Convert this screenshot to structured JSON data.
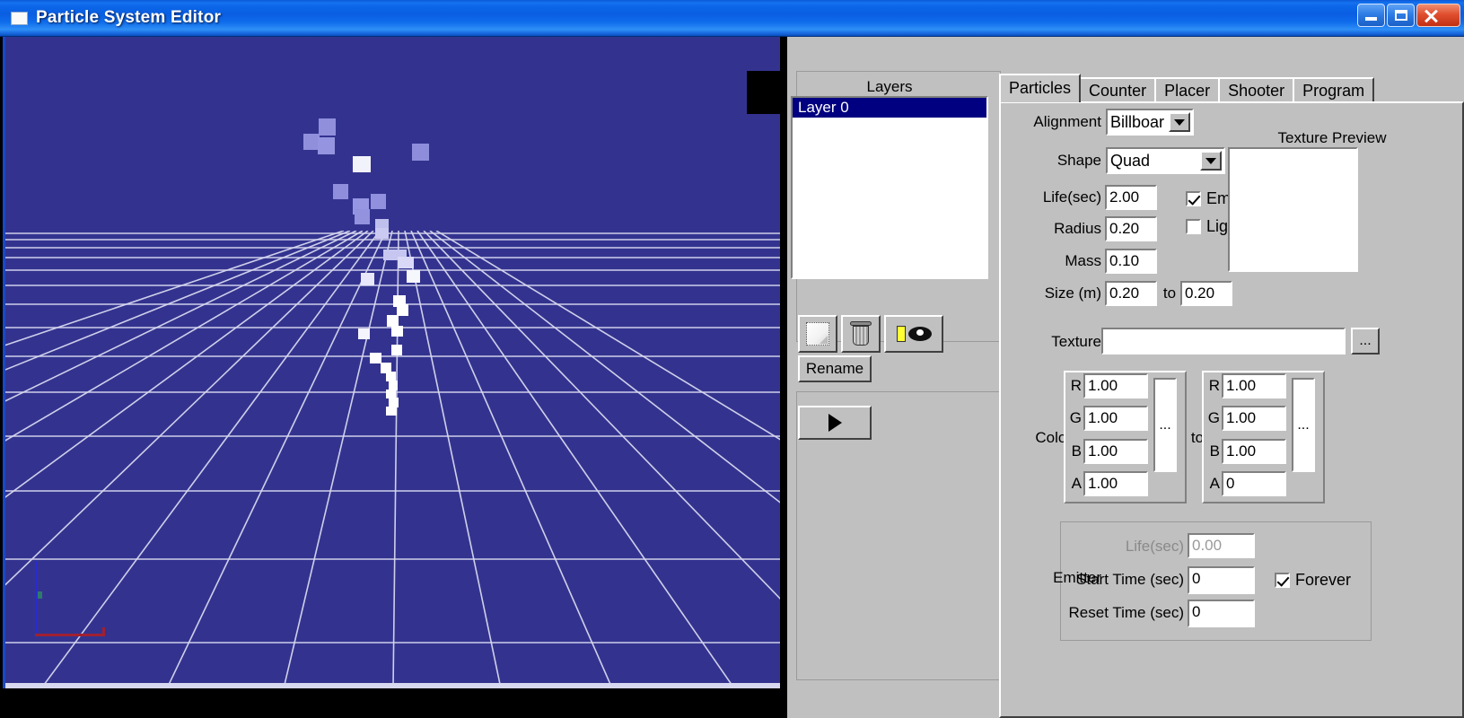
{
  "window": {
    "title": "Particle System Editor",
    "icon": "app-window-icon",
    "buttons": {
      "minimize": "minimize",
      "maximize": "maximize",
      "close": "close"
    }
  },
  "viewport": {
    "background_color": "#33338f",
    "grid_color": "#d8d8f0",
    "particle_color": "#ffffff",
    "axis_y_color": "#2a2ad0",
    "axis_x_color": "#a02030"
  },
  "layers_panel": {
    "title": "Layers",
    "items": [
      {
        "label": "Layer 0",
        "selected": true
      }
    ],
    "tools": [
      {
        "name": "new-layer",
        "icon": "page-icon"
      },
      {
        "name": "delete-layer",
        "icon": "trash-icon"
      },
      {
        "name": "layer-visibility",
        "icon": "eye-icon"
      }
    ],
    "rename_label": "Rename",
    "play_label": "play-icon"
  },
  "tabs": [
    {
      "label": "Particles",
      "active": true
    },
    {
      "label": "Counter",
      "active": false
    },
    {
      "label": "Placer",
      "active": false
    },
    {
      "label": "Shooter",
      "active": false
    },
    {
      "label": "Program",
      "active": false
    }
  ],
  "particles": {
    "alignment": {
      "label": "Alignment",
      "value": "Billboar"
    },
    "shape": {
      "label": "Shape",
      "value": "Quad"
    },
    "life": {
      "label": "Life(sec)",
      "value": "2.00"
    },
    "radius": {
      "label": "Radius",
      "value": "0.20"
    },
    "mass": {
      "label": "Mass",
      "value": "0.10"
    },
    "size": {
      "label": "Size (m)",
      "value_min": "0.20",
      "to_label": "to",
      "value_max": "0.20"
    },
    "emissive": {
      "label": "Emissive",
      "checked": true
    },
    "lighting": {
      "label": "Lighting",
      "checked": false
    },
    "texture_preview_label": "Texture Preview",
    "texture": {
      "label": "Texture",
      "value": "",
      "browse_label": "..."
    },
    "color": {
      "label": "Color",
      "to_label": "to",
      "swatch_label": "...",
      "start": {
        "r_label": "R",
        "r": "1.00",
        "g_label": "G",
        "g": "1.00",
        "b_label": "B",
        "b": "1.00",
        "a_label": "A",
        "a": "1.00"
      },
      "end": {
        "r_label": "R",
        "r": "1.00",
        "g_label": "G",
        "g": "1.00",
        "b_label": "B",
        "b": "1.00",
        "a_label": "A",
        "a": "0"
      }
    },
    "emitter": {
      "label": "Emitter",
      "life": {
        "label": "Life(sec)",
        "value": "0.00",
        "disabled": true
      },
      "start_time": {
        "label": "Start Time (sec)",
        "value": "0"
      },
      "reset_time": {
        "label": "Reset Time (sec)",
        "value": "0"
      },
      "forever": {
        "label": "Forever",
        "checked": true
      }
    }
  }
}
